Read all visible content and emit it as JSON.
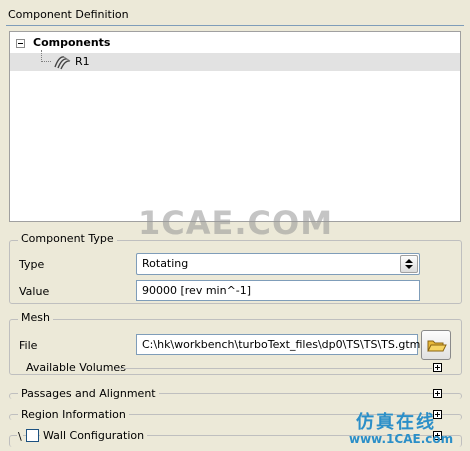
{
  "component_definition": {
    "title": "Component Definition",
    "tree": {
      "root_label": "Components",
      "child_label": "R1"
    }
  },
  "component_type": {
    "title": "Component Type",
    "type_label": "Type",
    "type_value": "Rotating",
    "value_label": "Value",
    "value_text": "90000 [rev min^-1]"
  },
  "mesh": {
    "title": "Mesh",
    "file_label": "File",
    "file_path": "C:\\hk\\workbench\\turboText_files\\dp0\\TS\\TS\\TS.gtm",
    "available_volumes_label": "Available Volumes"
  },
  "sections": {
    "passages_label": "Passages and Alignment",
    "region_label": "Region Information",
    "wall_prefix": "\\",
    "wall_label": "Wall Configuration"
  },
  "watermarks": {
    "center": "1CAE.COM",
    "chinese": "仿真在线",
    "url": "www.1CAE.com"
  },
  "icons": {
    "tree_collapse": "minus-box-icon",
    "rotor": "rotor-component-icon",
    "combo_arrow": "up-down-arrow-icon",
    "browse": "open-folder-icon",
    "expand": "plus-box-icon"
  },
  "colors": {
    "panel_bg": "#ece9d8",
    "selected_row": "#e2e2e2",
    "field_border": "#7f9db9",
    "watermark_blue": "#2b8fc8"
  }
}
